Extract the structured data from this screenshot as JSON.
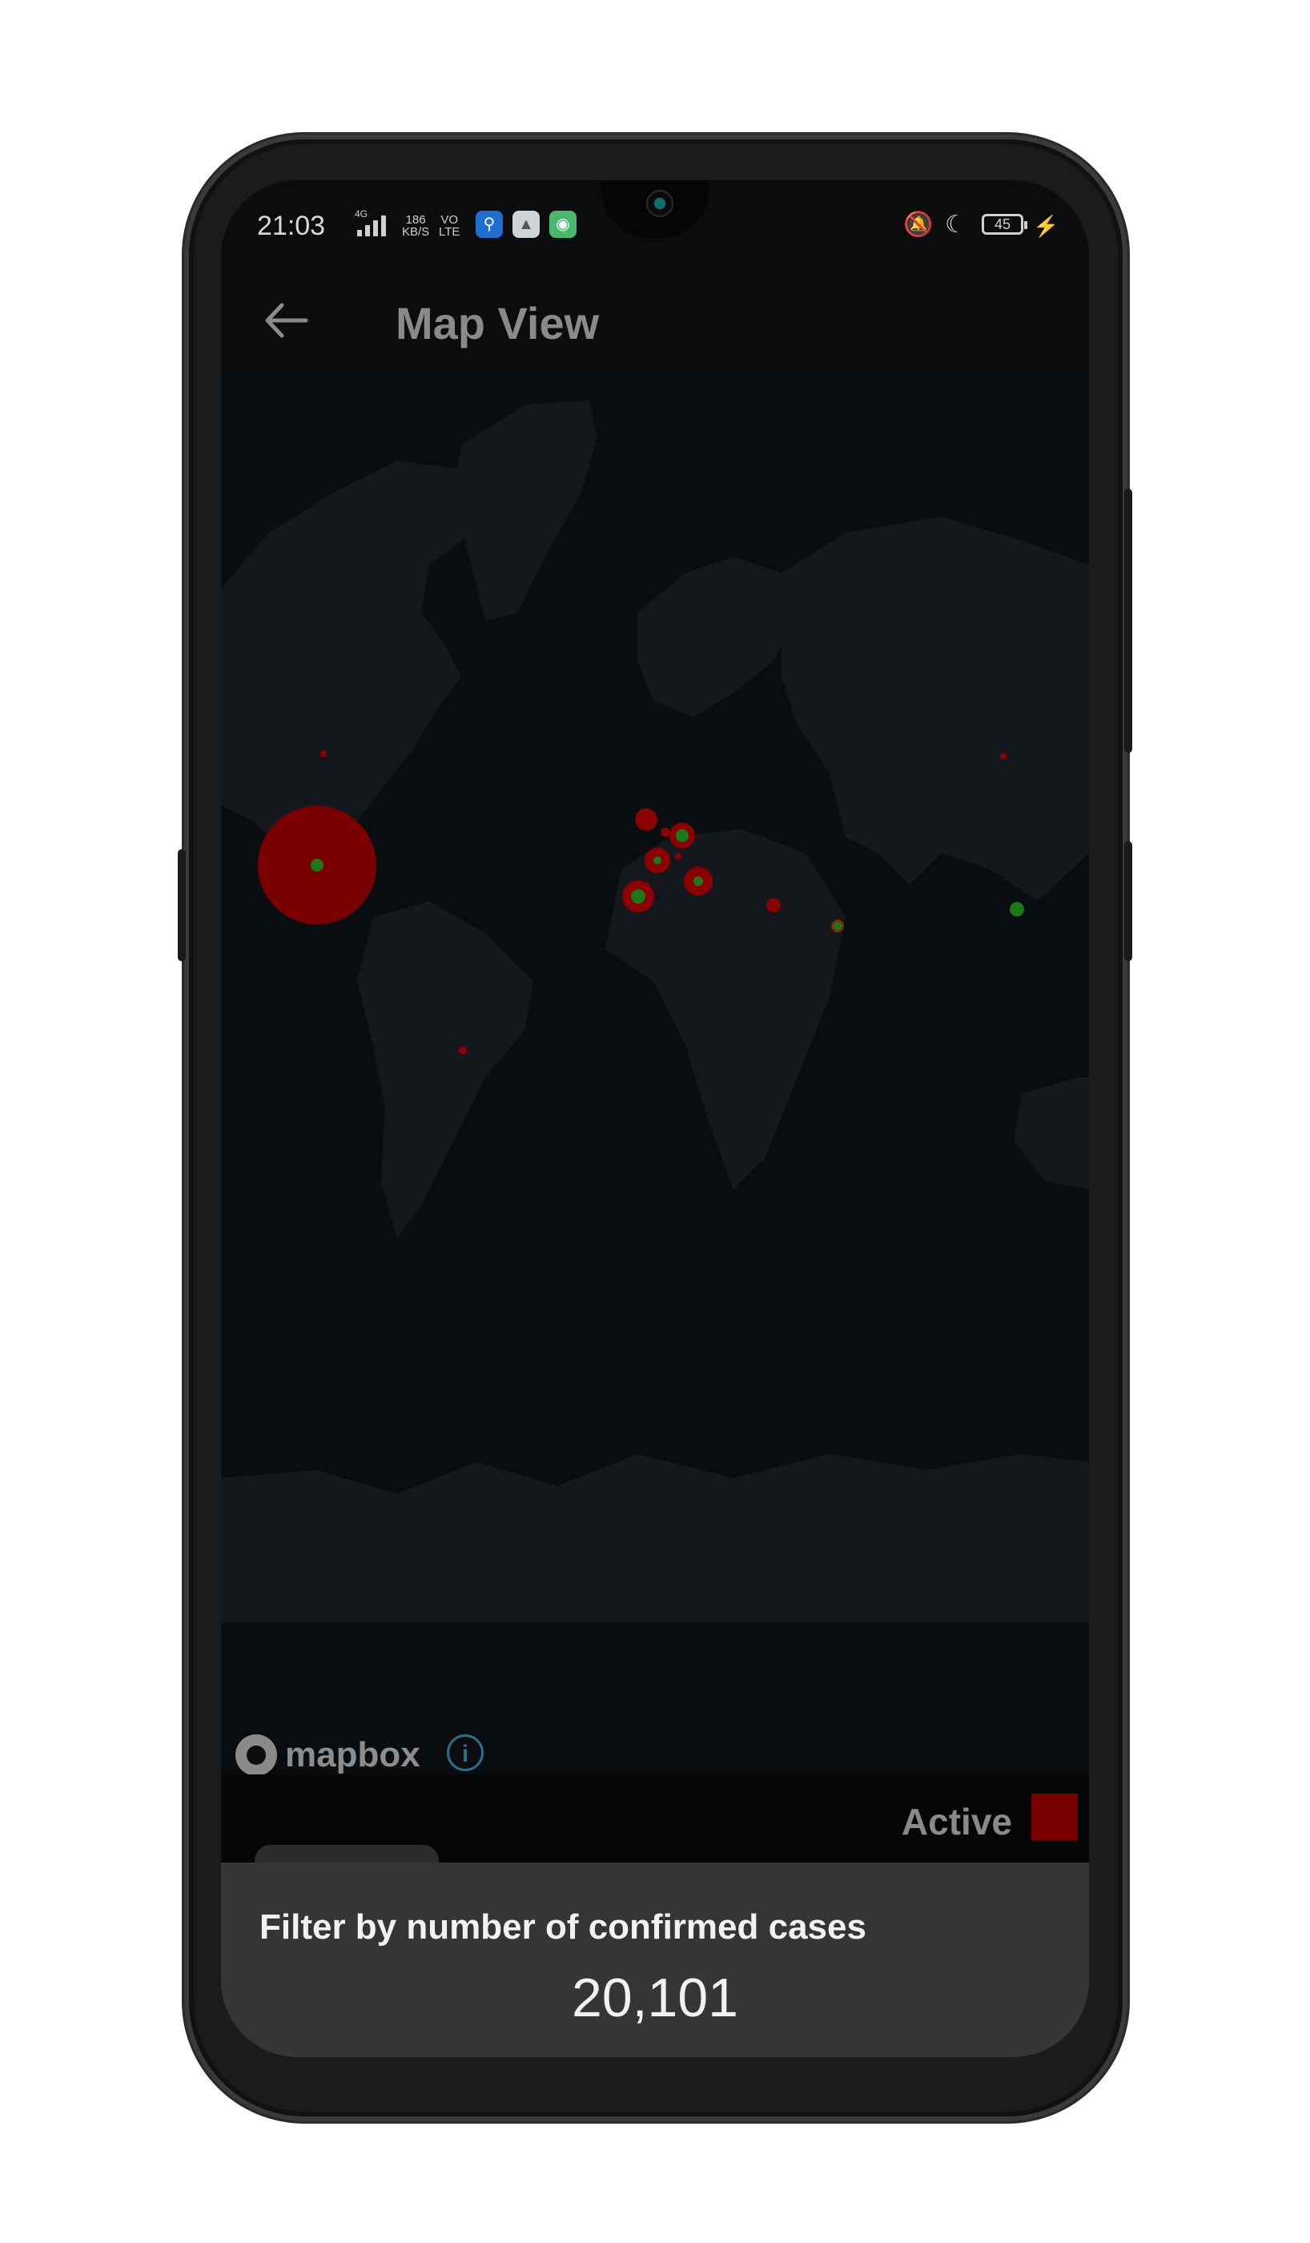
{
  "status_bar": {
    "time": "21:03",
    "network_type": "4G",
    "speed_value": "186",
    "speed_unit": "KB/S",
    "volte_top": "VO",
    "volte_bottom": "LTE",
    "battery_level": "45"
  },
  "toolbar": {
    "title": "Map View"
  },
  "map": {
    "attribution": "mapbox",
    "info_icon": "i"
  },
  "legend": {
    "label": "Active",
    "color": "#7a0000"
  },
  "filter_sheet": {
    "title": "Filter by number of confirmed cases",
    "value": "20,101",
    "slider_fraction": 0.2
  },
  "colors": {
    "active": "#8b0000",
    "recovered": "#1a8a1a",
    "slider": "#ff0a0a"
  },
  "icons": [
    "back-arrow-icon",
    "mute-icon",
    "moon-icon",
    "battery-icon",
    "charging-icon",
    "info-icon",
    "menu-nav-icon",
    "home-nav-icon",
    "back-nav-icon"
  ]
}
